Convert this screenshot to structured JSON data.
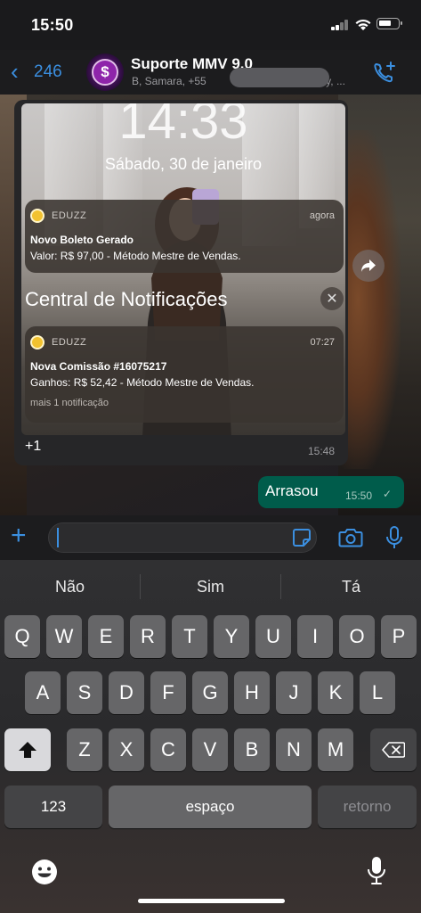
{
  "status_bar": {
    "time": "15:50"
  },
  "header": {
    "back_count": "246",
    "contact_name": "Suporte MMV 9.0",
    "contact_members_left": "B,  Samara, +55",
    "contact_members_right": "Affy, ..."
  },
  "incoming_message": {
    "screenshot": {
      "lock_clock": "14:33",
      "lock_date": "Sábado, 30 de janeiro",
      "notification_1": {
        "app": "EDUZZ",
        "time": "agora",
        "title": "Novo Boleto Gerado",
        "body": "Valor: R$ 97,00 - Método Mestre de Vendas."
      },
      "notification_center_title": "Central de Notificações",
      "notification_2": {
        "app": "EDUZZ",
        "time": "07:27",
        "title": "Nova Comissão #16075217",
        "body": "Ganhos: R$ 52,42 - Método Mestre de Vendas.",
        "more": "mais 1 notificação"
      }
    },
    "caption": "+1",
    "time": "15:48"
  },
  "outgoing_message": {
    "text": "Arrasou",
    "time": "15:50"
  },
  "input": {
    "placeholder": ""
  },
  "keyboard": {
    "suggestions": [
      "Não",
      "Sim",
      "Tá"
    ],
    "row1": [
      "Q",
      "W",
      "E",
      "R",
      "T",
      "Y",
      "U",
      "I",
      "O",
      "P"
    ],
    "row2": [
      "A",
      "S",
      "D",
      "F",
      "G",
      "H",
      "J",
      "K",
      "L"
    ],
    "row3": [
      "Z",
      "X",
      "C",
      "V",
      "B",
      "N",
      "M"
    ],
    "numbers_key": "123",
    "space_key": "espaço",
    "return_key": "retorno"
  },
  "colors": {
    "accent": "#3b8fe0",
    "outgoing_bubble": "#005c4b",
    "notif_icon": "#f2c230"
  }
}
